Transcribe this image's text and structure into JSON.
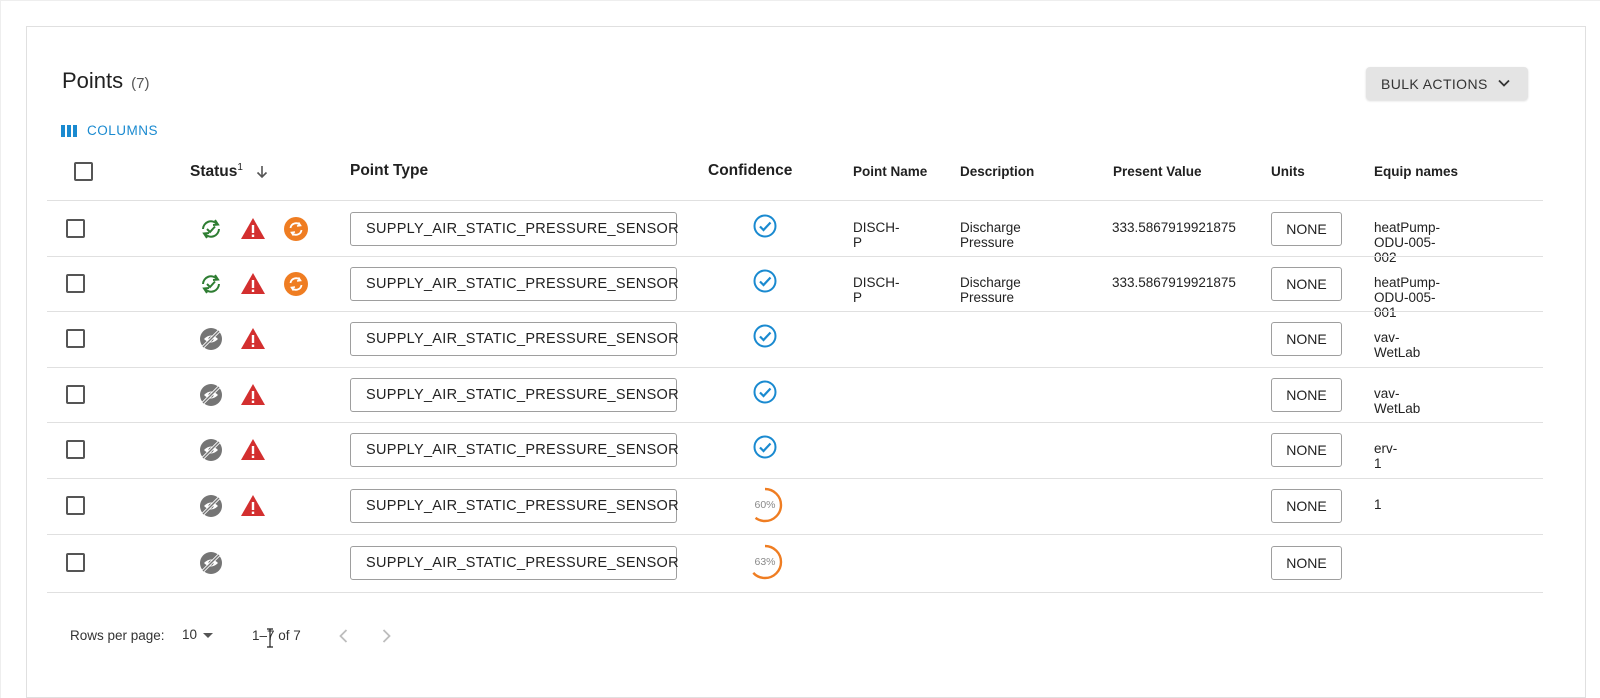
{
  "header": {
    "title": "Points",
    "count": "(7)",
    "bulk_actions_label": "BULK ACTIONS",
    "columns_label": "COLUMNS"
  },
  "table": {
    "columns": {
      "status": "Status",
      "status_sup": "1",
      "point_type": "Point Type",
      "confidence": "Confidence",
      "point_name": "Point Name",
      "description": "Description",
      "present_value": "Present Value",
      "units": "Units",
      "equip_names": "Equip names"
    },
    "rows": [
      {
        "status_icons": [
          "sync-check-icon",
          "warning-icon",
          "sync-orange-icon"
        ],
        "point_type": "SUPPLY_AIR_STATIC_PRESSURE_SENSOR",
        "confidence": "check",
        "point_name": "DISCH-P",
        "description": "Discharge Pressure",
        "present_value": "333.5867919921875",
        "units": "NONE",
        "equip_names": "heatPump-ODU-005-002"
      },
      {
        "status_icons": [
          "sync-check-icon",
          "warning-icon",
          "sync-orange-icon"
        ],
        "point_type": "SUPPLY_AIR_STATIC_PRESSURE_SENSOR",
        "confidence": "check",
        "point_name": "DISCH-P",
        "description": "Discharge Pressure",
        "present_value": "333.5867919921875",
        "units": "NONE",
        "equip_names": "heatPump-ODU-005-001"
      },
      {
        "status_icons": [
          "visibility-off-icon",
          "warning-icon"
        ],
        "point_type": "SUPPLY_AIR_STATIC_PRESSURE_SENSOR",
        "confidence": "check",
        "point_name": "",
        "description": "",
        "present_value": "",
        "units": "NONE",
        "equip_names": "vav-WetLab"
      },
      {
        "status_icons": [
          "visibility-off-icon",
          "warning-icon"
        ],
        "point_type": "SUPPLY_AIR_STATIC_PRESSURE_SENSOR",
        "confidence": "check",
        "point_name": "",
        "description": "",
        "present_value": "",
        "units": "NONE",
        "equip_names": "vav-WetLab"
      },
      {
        "status_icons": [
          "visibility-off-icon",
          "warning-icon"
        ],
        "point_type": "SUPPLY_AIR_STATIC_PRESSURE_SENSOR",
        "confidence": "check",
        "point_name": "",
        "description": "",
        "present_value": "",
        "units": "NONE",
        "equip_names": "erv-1"
      },
      {
        "status_icons": [
          "visibility-off-icon",
          "warning-icon"
        ],
        "point_type": "SUPPLY_AIR_STATIC_PRESSURE_SENSOR",
        "confidence": "60%",
        "confidence_fraction": 0.6,
        "point_name": "",
        "description": "",
        "present_value": "",
        "units": "NONE",
        "equip_names": "1"
      },
      {
        "status_icons": [
          "visibility-off-icon"
        ],
        "point_type": "SUPPLY_AIR_STATIC_PRESSURE_SENSOR",
        "confidence": "63%",
        "confidence_fraction": 0.63,
        "point_name": "",
        "description": "",
        "present_value": "",
        "units": "NONE",
        "equip_names": ""
      }
    ]
  },
  "footer": {
    "rows_per_page_label": "Rows per page:",
    "rows_per_page_value": "10",
    "range_text": "1–7 of 7"
  },
  "colors": {
    "accent": "#1a8ad0",
    "warning": "#d32f2f",
    "orange": "#ef7d22",
    "green": "#2e7d32",
    "muted": "#757575"
  }
}
